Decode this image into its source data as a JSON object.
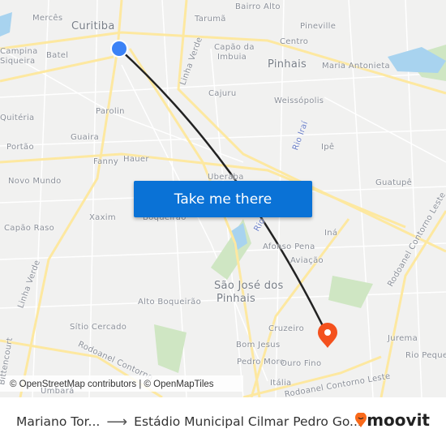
{
  "map": {
    "labels": [
      "Mercês",
      "Curitiba",
      "Bairro Alto",
      "Tarumã",
      "Pineville",
      "Campina",
      "Siqueira",
      "Batel",
      "Centro",
      "Capão da",
      "Imbuia",
      "Pinhais",
      "Maria Antonieta",
      "Linha Verde",
      "Cajuru",
      "Weissópolis",
      "Parolin",
      "Quitéria",
      "Rio Iraí",
      "Guaira",
      "Portão",
      "Ipê",
      "Fanny",
      "Hauer",
      "Uberaba",
      "Novo Mundo",
      "Guatupê",
      "Xaxim",
      "Boqueirão",
      "Capão Raso",
      "Rio",
      "Iná",
      "Afonso Pena",
      "Aviação",
      "Rodoanel Contorno Leste",
      "São José dos",
      "Pinhais",
      "Linha Verde",
      "Alto Boqueirão",
      "Sítio Cercado",
      "Cruzeiro",
      "Jurema",
      "Bom Jesus",
      "Rio Pequeno",
      "Rodoanel Contorno",
      "Pedro Moro",
      "Ouro Fino",
      "Itália",
      "Rodoanel Contorno Leste",
      "Umbará",
      "Bittencourt"
    ],
    "origin_color": "#3b82f6",
    "destination_color": "#f4511e",
    "route_color": "#222222",
    "origin_icon": "origin-dot-icon",
    "destination_icon": "map-pin-icon"
  },
  "cta": {
    "label": "Take me there"
  },
  "attribution": "© OpenStreetMap contributors | © OpenMapTiles",
  "footer": {
    "from": "Mariano Tor...",
    "arrow": "⟶",
    "to": "Estádio Municipal Cilmar Pedro Go...",
    "brand": "moovit",
    "brand_color": "#f96a1b"
  }
}
